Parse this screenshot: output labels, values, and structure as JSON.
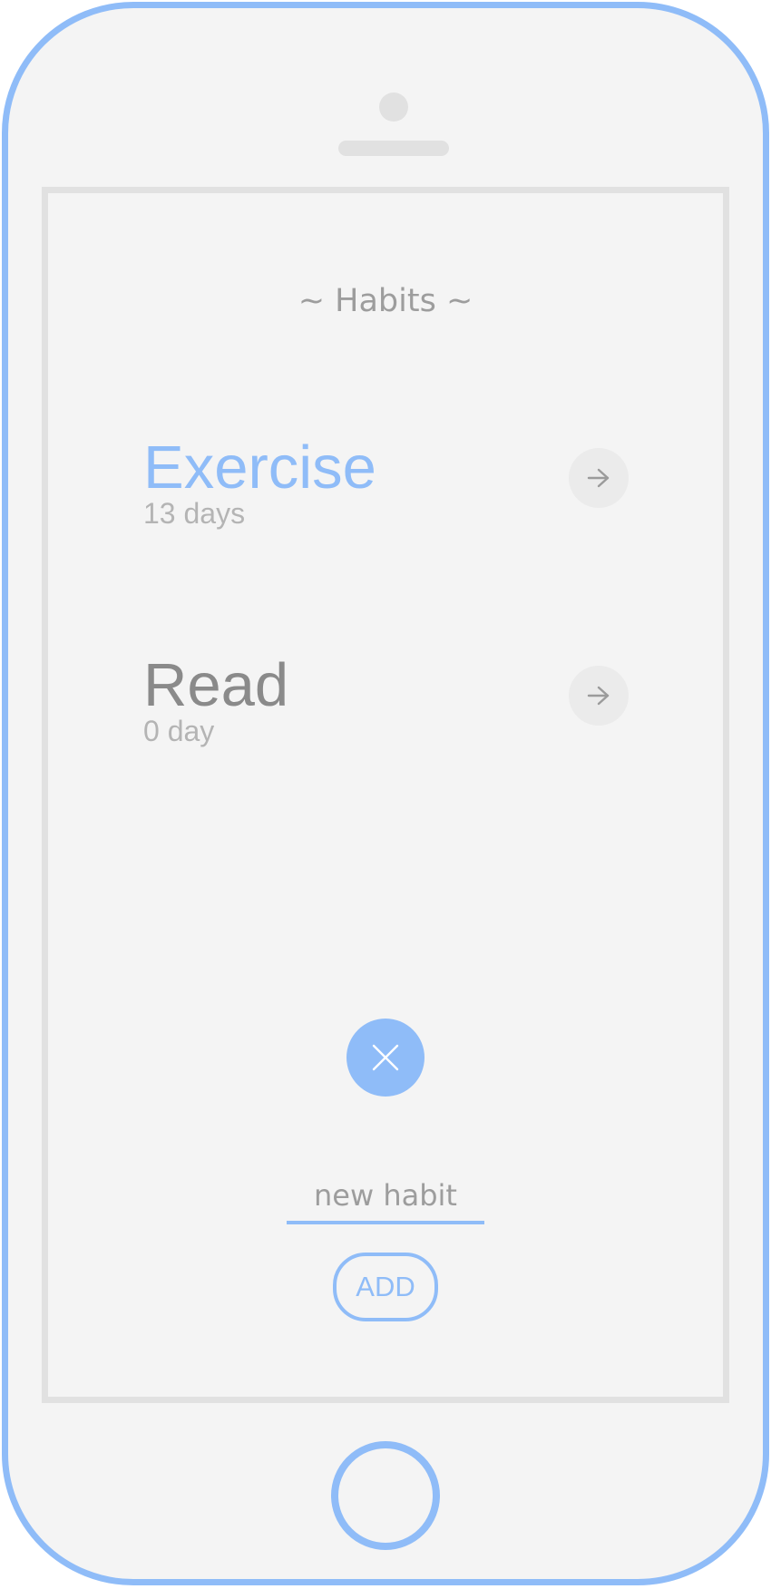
{
  "app": {
    "title": "~ Habits ~"
  },
  "habits": [
    {
      "name": "Exercise",
      "count": "13 days",
      "active": true
    },
    {
      "name": "Read",
      "count": "0 day",
      "active": false
    }
  ],
  "form": {
    "input_placeholder": "new habit",
    "add_label": "ADD"
  },
  "icons": {
    "habit_action": "arrow-right-icon",
    "close": "close-icon",
    "home": "home-button"
  },
  "colors": {
    "accent": "#8fbcf8",
    "frame_bg": "#f4f4f4",
    "muted_text": "#9d9d9d",
    "primary_text": "#8a8a8a",
    "secondary_text": "#b4b4b4"
  }
}
